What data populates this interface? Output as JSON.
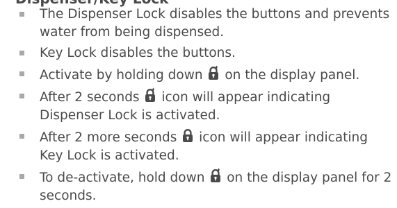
{
  "section": {
    "title": "Dispenser/Key Lock"
  },
  "bullets": {
    "b0": "The Dispenser Lock disables the buttons and prevents water from being dispensed.",
    "b1": "Key Lock disables the buttons.",
    "b2_before": "Activate by holding down ",
    "b2_after": " on the display panel.",
    "b3_before": "After 2 seconds ",
    "b3_after": " icon will appear indicating Dispenser Lock is activated.",
    "b4_before": "After 2 more seconds ",
    "b4_after": " icon will appear indicating Key Lock is activated.",
    "b5_before": "To de-activate, hold down ",
    "b5_after": " on the display panel for 2 seconds."
  },
  "icons": {
    "dispenser_lock": "dispenser-lock-icon",
    "key_lock": "key-lock-icon"
  },
  "colors": {
    "text": "#4a4a4a",
    "bullet": "#a8a8a8"
  }
}
